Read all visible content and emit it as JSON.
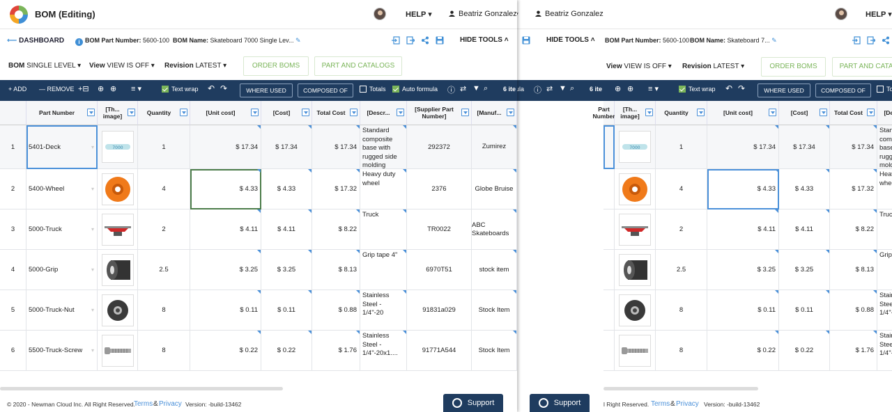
{
  "app": {
    "title": "BOM (Editing)",
    "help": "HELP",
    "user": "Beatriz Gonzalez"
  },
  "subbar": {
    "dashboard": "DASHBOARD",
    "part_number_label": "BOM Part Number:",
    "part_number": "5600-100",
    "name_label": "BOM Name:",
    "name_left": "Skateboard 7000 Single Lev...",
    "name_right": "Skateboard 7...",
    "hide_tools": "HIDE TOOLS"
  },
  "controls": {
    "bom_label": "BOM",
    "bom_value": "SINGLE LEVEL",
    "view_label": "View",
    "view_value": "VIEW IS OFF",
    "revision_label": "Revision",
    "revision_value": "LATEST",
    "order_boms": "ORDER BOMS",
    "part_catalogs": "PART AND CATALOGS"
  },
  "toolbar": {
    "add": "ADD",
    "remove": "REMOVE",
    "text_wrap": "Text wrap",
    "where_used": "WHERE USED",
    "composed_of": "COMPOSED OF",
    "totals": "Totals",
    "auto_formula": "Auto formula",
    "items": "6 ite"
  },
  "columns": [
    "Part Number",
    "[Th... image]",
    "Quantity",
    "[Unit cost]",
    "[Cost]",
    "Total Cost",
    "[Descr...",
    "[Supplier Part Number]",
    "[Manuf..."
  ],
  "rows": [
    {
      "n": "1",
      "part": "5401-Deck",
      "qty": "1",
      "unit": "$ 17.34",
      "cost": "$ 17.34",
      "total": "$ 17.34",
      "desc": "Standard composite base with rugged side molding",
      "supplier": "292372",
      "manuf": "Zumirez",
      "img": "deck"
    },
    {
      "n": "2",
      "part": "5400-Wheel",
      "qty": "4",
      "unit": "$ 4.33",
      "cost": "$ 4.33",
      "total": "$ 17.32",
      "desc": "Heavy duty wheel",
      "supplier": "2376",
      "manuf": "Globe Bruise",
      "img": "wheel"
    },
    {
      "n": "3",
      "part": "5000-Truck",
      "qty": "2",
      "unit": "$ 4.11",
      "cost": "$ 4.11",
      "total": "$ 8.22",
      "desc": "Truck",
      "supplier": "TR0022",
      "manuf": "ABC Skateboards",
      "img": "truck"
    },
    {
      "n": "4",
      "part": "5000-Grip",
      "qty": "2.5",
      "unit": "$ 3.25",
      "cost": "$ 3.25",
      "total": "$ 8.13",
      "desc": "Grip tape 4\"",
      "supplier": "6970T51",
      "manuf": "stock item",
      "img": "grip"
    },
    {
      "n": "5",
      "part": "5000-Truck-Nut",
      "qty": "8",
      "unit": "$ 0.11",
      "cost": "$ 0.11",
      "total": "$ 0.88",
      "desc": "Stainless Steel - 1/4\"-20",
      "supplier": "91831a029",
      "manuf": "Stock Item",
      "img": "nut"
    },
    {
      "n": "6",
      "part": "5500-Truck-Screw",
      "qty": "8",
      "unit": "$ 0.22",
      "cost": "$ 0.22",
      "total": "$ 1.76",
      "desc": "Stainless Steel - 1/4\"-20x1....",
      "supplier": "91771A544",
      "manuf": "Stock Item",
      "img": "screw"
    }
  ],
  "footer": {
    "copyright_left": "© 2020 - Newman Cloud Inc. All Right Reserved.",
    "copyright_right": "l Right Reserved.",
    "terms": "Terms",
    "amp": "&",
    "privacy": "Privacy",
    "version": "Version: -build-13462",
    "support": "Support"
  },
  "colors": {
    "navy": "#1f3c5f",
    "accent": "#4a90d9",
    "green": "#7bb55a"
  }
}
